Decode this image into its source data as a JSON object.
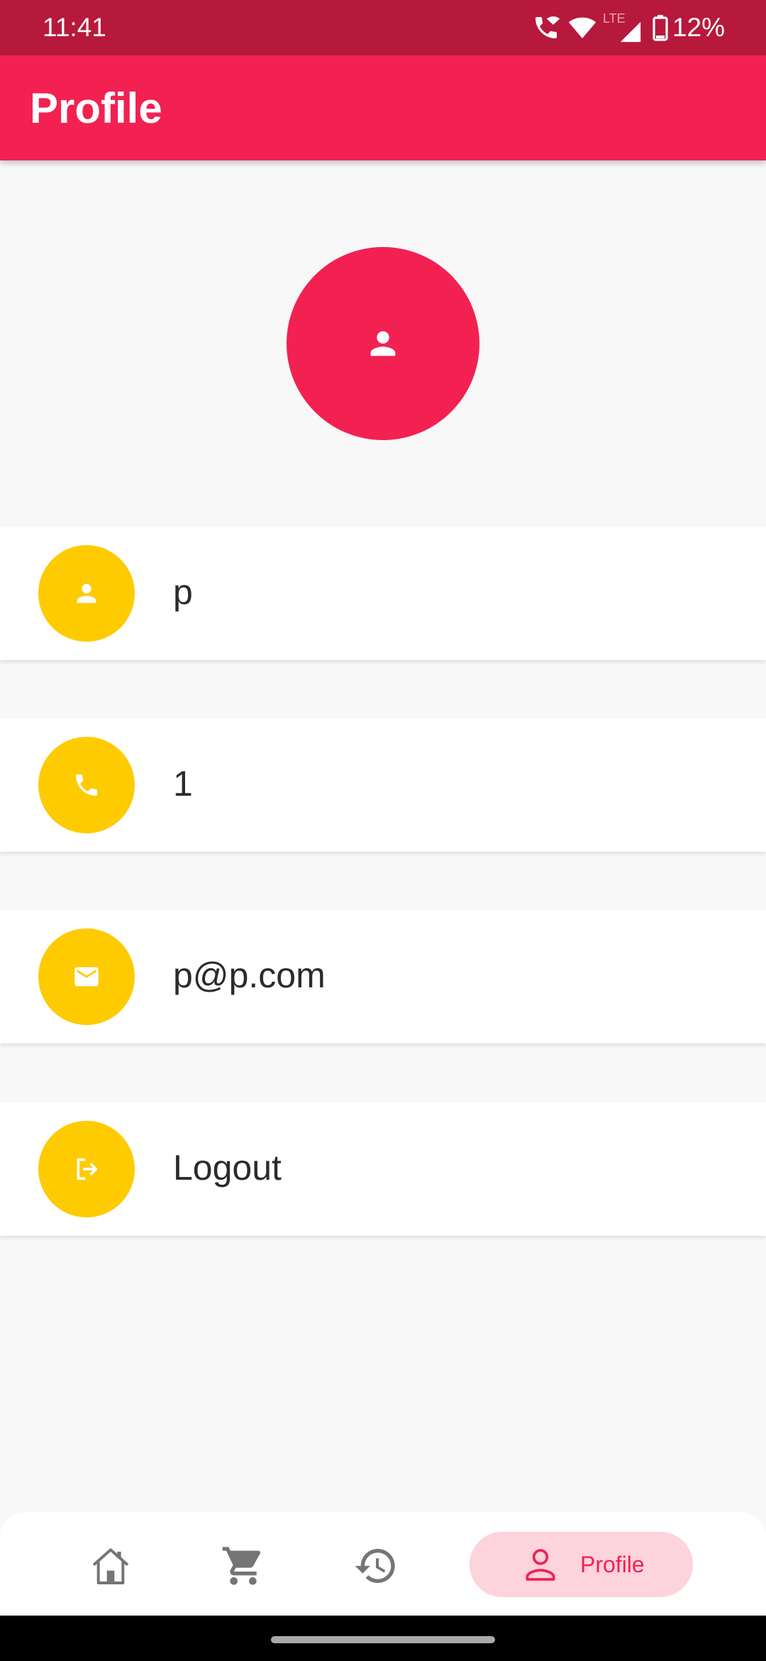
{
  "status_bar": {
    "time": "11:41",
    "battery": "12%",
    "network_label": "LTE",
    "icons": [
      "wifi-call-icon",
      "wifi-icon",
      "lte-signal-icon",
      "battery-icon"
    ]
  },
  "app_bar": {
    "title": "Profile"
  },
  "profile": {
    "avatar_icon": "person-icon",
    "rows": [
      {
        "key": "name",
        "icon": "person-icon",
        "value": "p"
      },
      {
        "key": "phone",
        "icon": "phone-icon",
        "value": "1"
      },
      {
        "key": "email",
        "icon": "mail-icon",
        "value": "p@p.com"
      },
      {
        "key": "logout",
        "icon": "logout-icon",
        "value": "Logout"
      }
    ]
  },
  "bottom_nav": {
    "items": [
      {
        "key": "home",
        "icon": "home-icon"
      },
      {
        "key": "cart",
        "icon": "cart-icon"
      },
      {
        "key": "history",
        "icon": "history-icon"
      },
      {
        "key": "profile",
        "icon": "person-outline-icon",
        "label": "Profile",
        "selected": true
      }
    ]
  },
  "colors": {
    "status_bar": "#b7193c",
    "primary": "#f22152",
    "accent_yellow": "#fecb00",
    "background": "#f8f8f8",
    "nav_selected_bg": "#fdd3dc",
    "nav_inactive": "#757575",
    "text": "#2b2b2b"
  }
}
